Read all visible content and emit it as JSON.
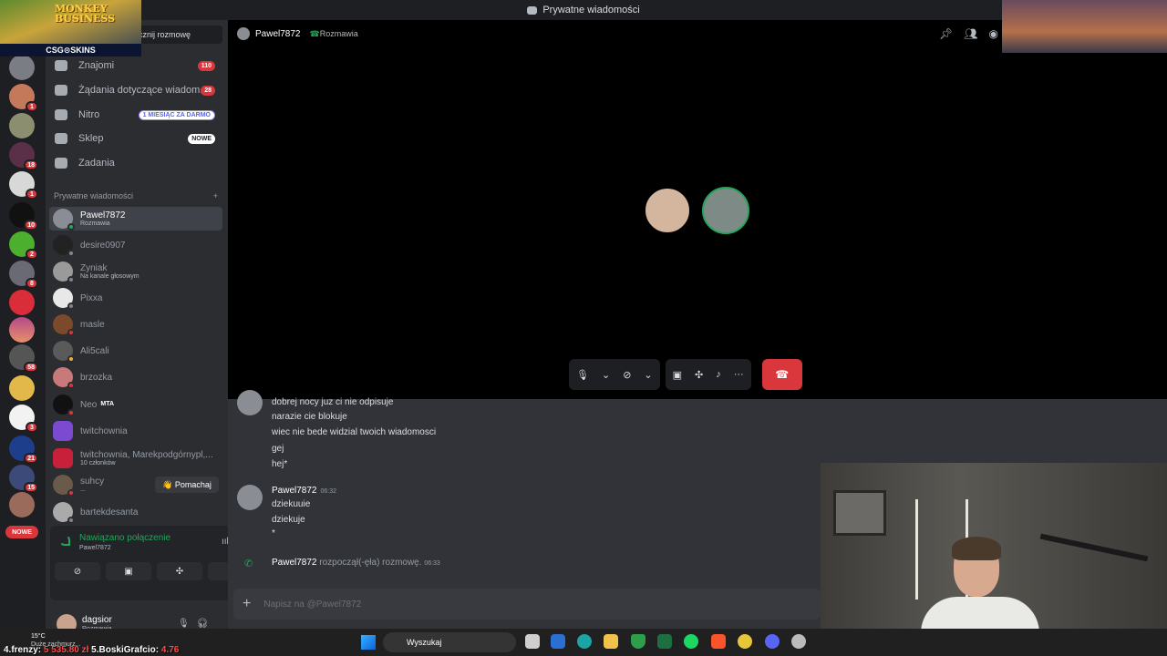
{
  "titlebar": {
    "title": "Prywatne wiadomości"
  },
  "overlay": {
    "logo_line1": "MONKEY",
    "logo_line2": "BUSINESS",
    "sponsor": "CSG⊙SKINS",
    "ticker": {
      "item1_name": "4.frenzy:",
      "item1_value": "5 535.80 zł",
      "item2_name": "5.BoskiGrafcio:",
      "item2_value": "4.76"
    }
  },
  "rail": {
    "badges": [
      "1",
      "18",
      "1",
      "10",
      "2",
      "8",
      "58",
      "3",
      "21",
      "15"
    ],
    "nowe": "NOWE"
  },
  "sidebar": {
    "find_text": "cznij rozmowę",
    "nav": [
      {
        "label": "Znajomi",
        "badge": "110"
      },
      {
        "label": "Żądania dotyczące wiadom...",
        "badge": "28"
      },
      {
        "label": "Nitro",
        "badge": "1 MIESIĄC ZA DARMO"
      },
      {
        "label": "Sklep",
        "badge": "NOWE"
      },
      {
        "label": "Zadania",
        "badge": ""
      }
    ],
    "dm_header": "Prywatne wiadomości",
    "dm_add": "+",
    "dms": [
      {
        "name": "Pawel7872",
        "sub": "Rozmawia"
      },
      {
        "name": "desire0907",
        "sub": ""
      },
      {
        "name": "Zyniak",
        "sub": "Na kanale głosowym"
      },
      {
        "name": "Pixxa",
        "sub": ""
      },
      {
        "name": "masle",
        "sub": ""
      },
      {
        "name": "Ali5cali",
        "sub": ""
      },
      {
        "name": "brzozka",
        "sub": ""
      },
      {
        "name": "Neo",
        "sub": ""
      },
      {
        "name": "twitchownia",
        "sub": ""
      },
      {
        "name": "twitchownia, Marekpodgórnypl,...",
        "sub": "10 członków"
      },
      {
        "name": "suhcy",
        "sub": "..."
      },
      {
        "name": "bartekdesanta",
        "sub": ""
      }
    ],
    "neo_tag": "MTA",
    "wave_button": "👋 Pomachaj"
  },
  "voice": {
    "status": "Nawiązano połączenie",
    "channel": "Pawel7872"
  },
  "user": {
    "name": "dagsior",
    "status": "Rozmawia"
  },
  "call": {
    "peer_name": "Pawel7872",
    "peer_status": "Rozmawia"
  },
  "chat": {
    "messages_block1": [
      "dobrej nocy juz ci nie odpisuje",
      "narazie cie blokuje",
      "wiec nie bede widzial twoich wiadomosci",
      "gej",
      "hej*"
    ],
    "author2": "Pawel7872",
    "time2": "06:32",
    "messages_block2": [
      "dziekuuie",
      "dziekuje",
      "*"
    ],
    "call_author": "Pawel7872",
    "call_text": "rozpoczął(-ęła) rozmowę.",
    "call_time": "06:33",
    "composer_placeholder": "Napisz na @Pawel7872"
  },
  "taskbar": {
    "temp": "15°C",
    "weather": "Duże zachmurz...",
    "search_label": "Wyszukaj"
  },
  "colors": {
    "accent_red": "#da373c",
    "online_green": "#23a55a",
    "blurple": "#5865f2"
  }
}
